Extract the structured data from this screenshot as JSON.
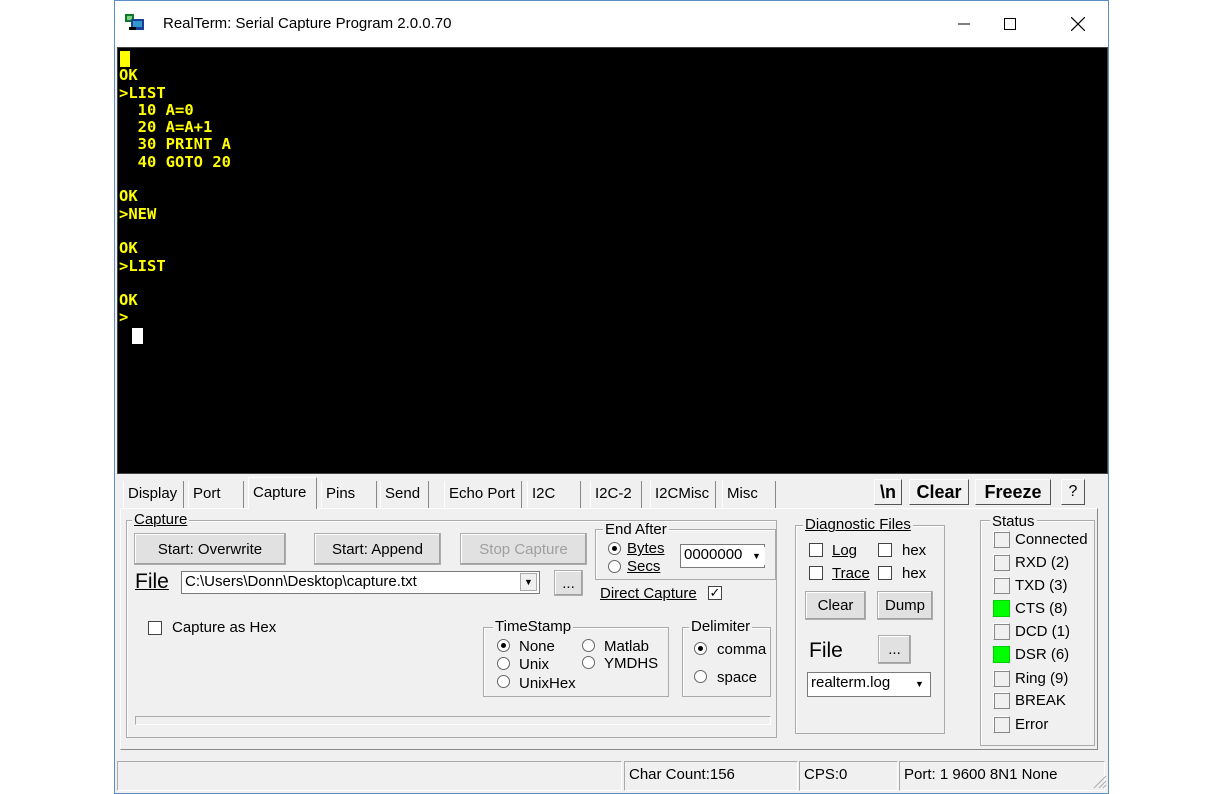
{
  "window": {
    "title": "RealTerm: Serial Capture Program 2.0.0.70"
  },
  "terminal": {
    "lines": "\nOK\n>LIST\n  10 A=0\n  20 A=A+1\n  30 PRINT A\n  40 GOTO 20\n\nOK\n>NEW\n\nOK\n>LIST\n\nOK\n>"
  },
  "tabs": [
    "Display",
    "Port",
    "Capture",
    "Pins",
    "Send",
    "Echo Port",
    "I2C",
    "I2C-2",
    "I2CMisc",
    "Misc"
  ],
  "toolbar": {
    "newline_label": "\\n",
    "clear_label": "Clear",
    "freeze_label": "Freeze",
    "help_label": "?"
  },
  "capture": {
    "group_label": "Capture",
    "start_overwrite": "Start: Overwrite",
    "start_append": "Start: Append",
    "stop_capture": "Stop Capture",
    "file_label": "File",
    "file_path": "C:\\Users\\Donn\\Desktop\\capture.txt",
    "browse_label": "...",
    "capture_as_hex": "Capture as Hex",
    "end_after": {
      "label": "End After",
      "bytes": "Bytes",
      "secs": "Secs",
      "value": "0000000"
    },
    "direct_capture": "Direct Capture",
    "timestamp": {
      "label": "TimeStamp",
      "none": "None",
      "matlab": "Matlab",
      "unix": "Unix",
      "ymdhs": "YMDHS",
      "unixhex": "UnixHex"
    },
    "delimiter": {
      "label": "Delimiter",
      "comma": "comma",
      "space": "space"
    }
  },
  "diagnostic": {
    "label": "Diagnostic Files",
    "log": "Log",
    "hex1": "hex",
    "trace": "Trace",
    "hex2": "hex",
    "clear": "Clear",
    "dump": "Dump",
    "file_label": "File",
    "browse": "...",
    "file_value": "realterm.log"
  },
  "status": {
    "label": "Status",
    "items": [
      {
        "label": "Connected",
        "on": false
      },
      {
        "label": "RXD (2)",
        "on": false
      },
      {
        "label": "TXD (3)",
        "on": false
      },
      {
        "label": "CTS (8)",
        "on": true
      },
      {
        "label": "DCD (1)",
        "on": false
      },
      {
        "label": "DSR (6)",
        "on": true
      },
      {
        "label": "Ring (9)",
        "on": false
      },
      {
        "label": "BREAK",
        "on": false
      },
      {
        "label": "Error",
        "on": false
      }
    ],
    "led_on_color": "#00ff00"
  },
  "statusbar": {
    "char_count": "Char Count:156",
    "cps": "CPS:0",
    "port": "Port: 1 9600 8N1 None"
  }
}
